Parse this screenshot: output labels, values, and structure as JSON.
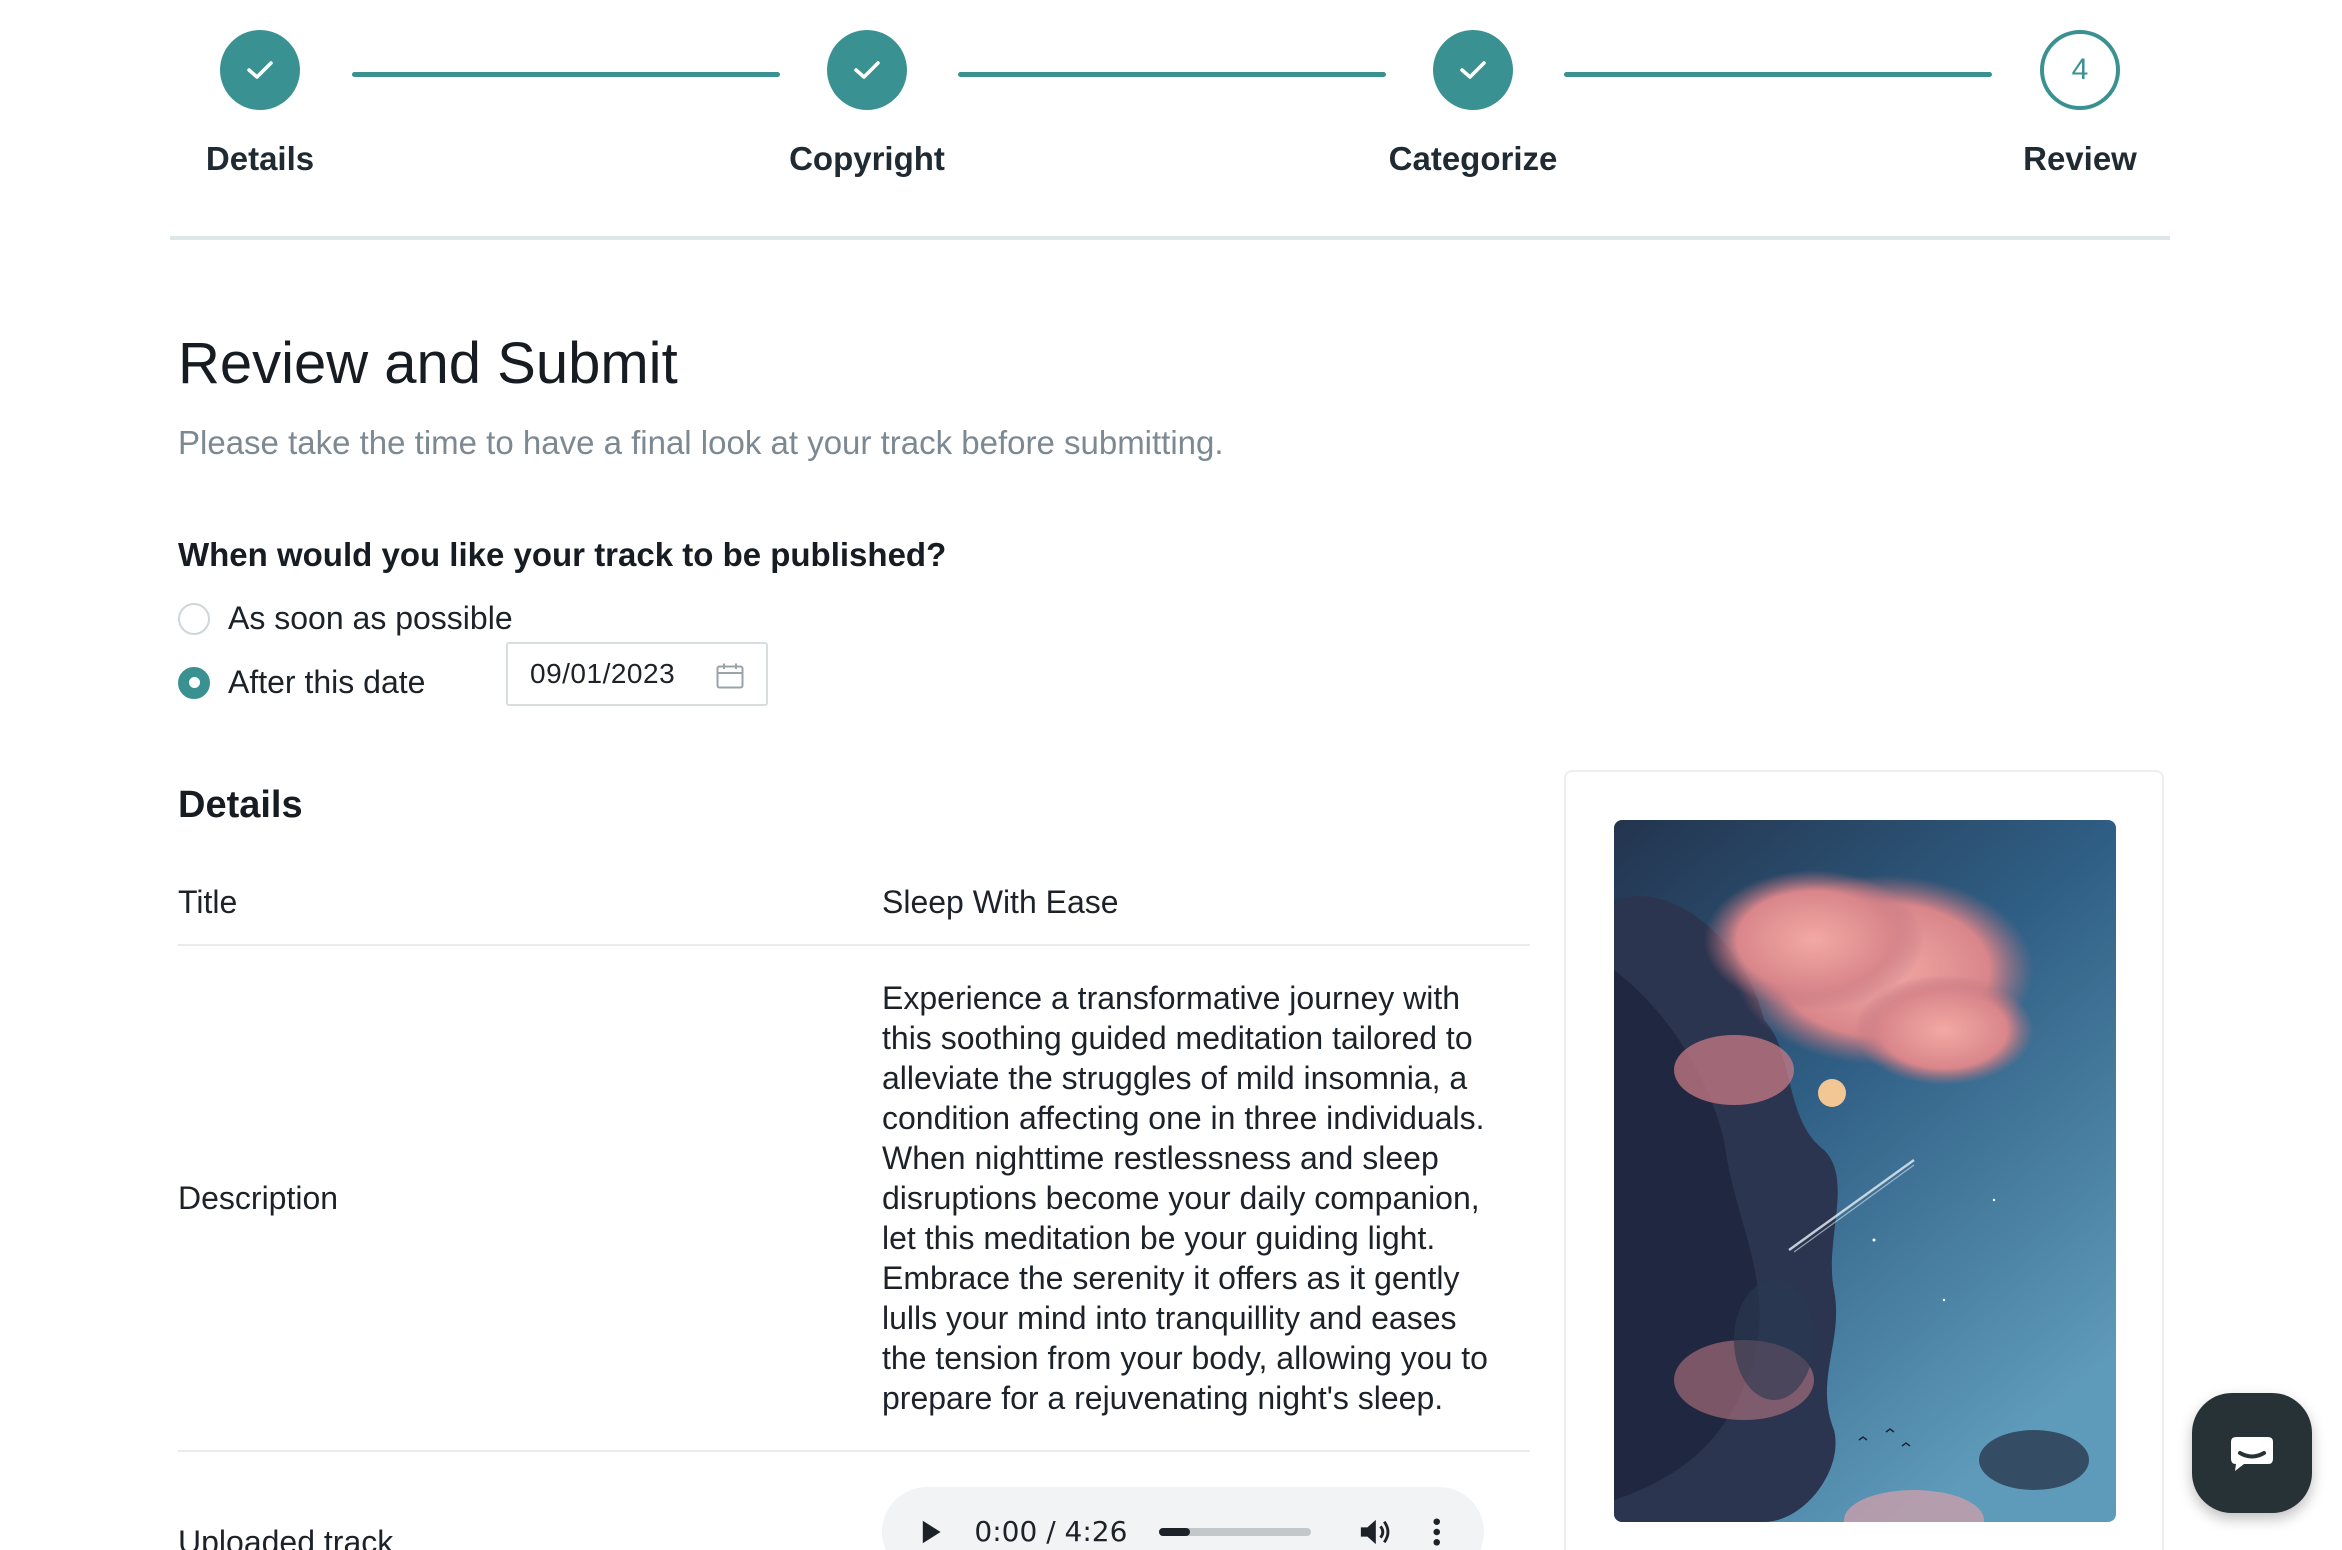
{
  "stepper": {
    "steps": [
      {
        "label": "Details",
        "state": "done"
      },
      {
        "label": "Copyright",
        "state": "done"
      },
      {
        "label": "Categorize",
        "state": "done"
      },
      {
        "label": "Review",
        "state": "current",
        "number": "4"
      }
    ]
  },
  "header": {
    "title": "Review and Submit",
    "subtitle": "Please take the time to have a final look at your track before submitting."
  },
  "publish": {
    "question": "When would you like your track to be published?",
    "options": [
      {
        "label": "As soon as possible",
        "checked": false
      },
      {
        "label": "After this date",
        "checked": true
      }
    ],
    "date_value": "09/01/2023"
  },
  "details": {
    "section_title": "Details",
    "title_label": "Title",
    "title_value": "Sleep With Ease",
    "description_label": "Description",
    "description_value": "Experience a transformative journey with this soothing guided meditation tailored to alleviate the struggles of mild insomnia, a condition affecting one in three individuals. When nighttime restlessness and sleep disruptions become your daily companion, let this meditation be your guiding light. Embrace the serenity it offers as it gently lulls your mind into tranquillity and eases the tension from your body, allowing you to prepare for a rejuvenating night's sleep.",
    "track_label": "Uploaded track",
    "audio": {
      "time": "0:00 / 4:26",
      "progress": 0.2
    }
  },
  "colors": {
    "accent": "#3a9191",
    "chat_button": "#263236"
  },
  "icons": [
    "check-icon",
    "calendar-icon",
    "play-icon",
    "volume-icon",
    "more-vertical-icon",
    "chat-icon"
  ]
}
